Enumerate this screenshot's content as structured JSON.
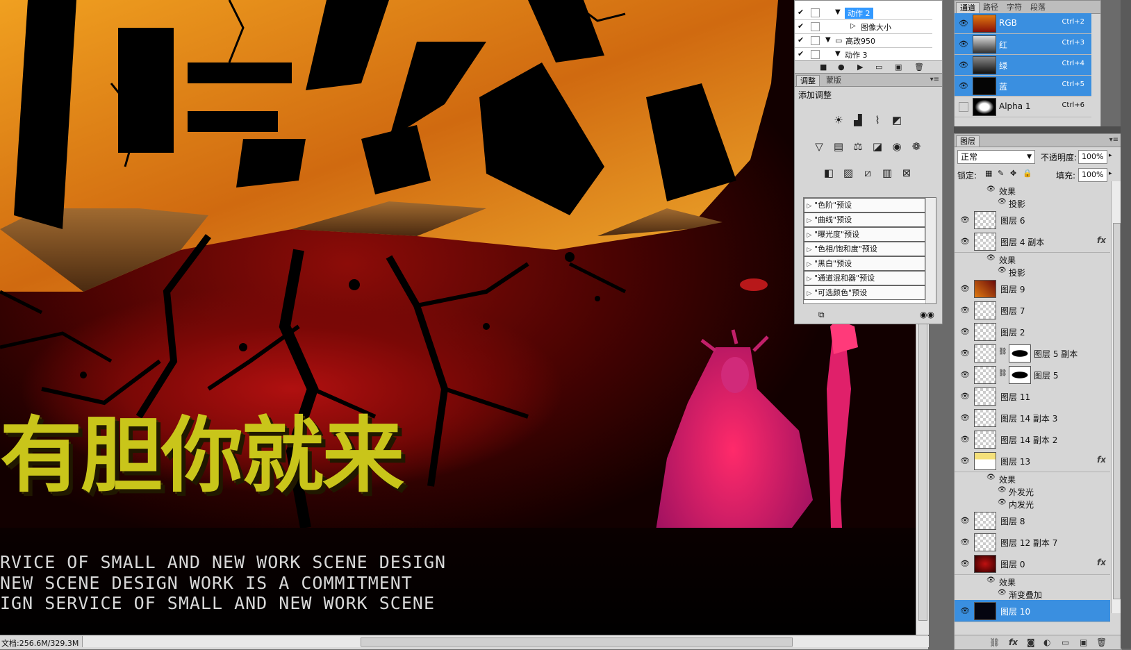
{
  "status": {
    "doc_info": "文档:256.6M/329.3M"
  },
  "canvas": {
    "yellow_title": "有胆你就来",
    "english_lines": [
      "RVICE OF SMALL  AND NEW WORK SCENE DESIGN",
      "NEW SCENE DESIGN WORK IS A COMMITMENT",
      "IGN SERVICE OF SMALL  AND NEW WORK SCENE"
    ]
  },
  "actions": {
    "rows": [
      {
        "label": "动作 2",
        "selected": true
      },
      {
        "label": "图像大小",
        "selected": false
      },
      {
        "label": "高改950",
        "selected": false
      },
      {
        "label": "动作 3",
        "selected": false
      }
    ]
  },
  "adjustments": {
    "tabs": [
      "调整",
      "蒙版"
    ],
    "header": "添加调整",
    "presets": [
      "\"色阶\"预设",
      "\"曲线\"预设",
      "\"曝光度\"预设",
      "\"色相/饱和度\"预设",
      "\"黑白\"预设",
      "\"通道混和器\"预设",
      "\"可选颜色\"预设"
    ]
  },
  "channels": {
    "tabs": [
      "通道",
      "路径",
      "字符",
      "段落"
    ],
    "rows": [
      {
        "name": "RGB",
        "key": "Ctrl+2",
        "selected": true
      },
      {
        "name": "红",
        "key": "Ctrl+3",
        "selected": true
      },
      {
        "name": "绿",
        "key": "Ctrl+4",
        "selected": true
      },
      {
        "name": "蓝",
        "key": "Ctrl+5",
        "selected": true
      },
      {
        "name": "Alpha 1",
        "key": "Ctrl+6",
        "selected": false
      }
    ]
  },
  "layers": {
    "tab": "图层",
    "blend_mode": "正常",
    "opacity_label": "不透明度:",
    "opacity_value": "100%",
    "lock_label": "锁定:",
    "fill_label": "填充:",
    "fill_value": "100%",
    "effects_label": "效果",
    "items": [
      {
        "name": "投影"
      },
      {
        "name": "图层 6"
      },
      {
        "name": "图层 4 副本"
      },
      {
        "name": "投影"
      },
      {
        "name": "图层 9"
      },
      {
        "name": "图层 7"
      },
      {
        "name": "图层 2"
      },
      {
        "name": "图层 5 副本"
      },
      {
        "name": "图层 5"
      },
      {
        "name": "图层 11"
      },
      {
        "name": "图层 14 副本 3"
      },
      {
        "name": "图层 14 副本 2"
      },
      {
        "name": "图层 13"
      },
      {
        "name": "外发光"
      },
      {
        "name": "内发光"
      },
      {
        "name": "图层 8"
      },
      {
        "name": "图层 12 副本 7"
      },
      {
        "name": "图层 0"
      },
      {
        "name": "渐变叠加"
      },
      {
        "name": "图层 10"
      }
    ]
  },
  "colors": {
    "selection": "#3a8fe0",
    "canvas_red": "#8c0c08",
    "title_yellow": "#c9c51a",
    "fire_orange": "#e08a18"
  }
}
